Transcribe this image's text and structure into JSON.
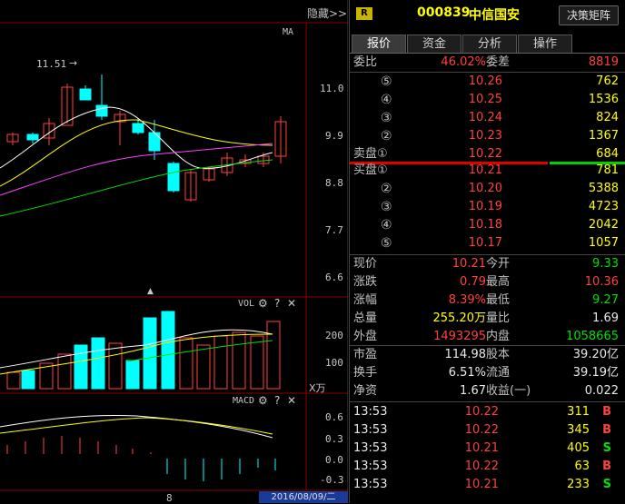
{
  "left": {
    "hide_label": "隐藏>>",
    "ma_label": "MA",
    "high_marker": "11.51",
    "price_ticks": [
      "11.0",
      "9.9",
      "8.8",
      "7.7",
      "6.6"
    ],
    "vol_label": "VOL",
    "vol_ticks": [
      "200",
      "100"
    ],
    "vol_unit": "X万",
    "macd_label": "MACD",
    "macd_ticks": [
      "0.6",
      "0.3",
      "0.0",
      "-0.3"
    ],
    "bottom_mark": "8",
    "date_label": "2016/08/09/二"
  },
  "header": {
    "badge": "R",
    "code": "000839",
    "name": "中信国安",
    "decision_button": "决策矩阵"
  },
  "tabs": [
    "报价",
    "资金",
    "分析",
    "操作"
  ],
  "weibi": {
    "label1": "委比",
    "value1": "46.02%",
    "label2": "委差",
    "value2": "8819"
  },
  "asks": [
    {
      "level": "⑤",
      "price": "10.26",
      "vol": "762"
    },
    {
      "level": "④",
      "price": "10.25",
      "vol": "1536"
    },
    {
      "level": "③",
      "price": "10.24",
      "vol": "824"
    },
    {
      "level": "②",
      "price": "10.23",
      "vol": "1367"
    },
    {
      "level": "卖盘①",
      "price": "10.22",
      "vol": "684"
    }
  ],
  "bids": [
    {
      "level": "买盘①",
      "price": "10.21",
      "vol": "781"
    },
    {
      "level": "②",
      "price": "10.20",
      "vol": "5388"
    },
    {
      "level": "③",
      "price": "10.19",
      "vol": "4723"
    },
    {
      "level": "④",
      "price": "10.18",
      "vol": "2042"
    },
    {
      "level": "⑤",
      "price": "10.17",
      "vol": "1057"
    }
  ],
  "stats": [
    {
      "l1": "现价",
      "v1": "10.21",
      "c1": "red",
      "l2": "今开",
      "v2": "9.33",
      "c2": "green"
    },
    {
      "l1": "涨跌",
      "v1": "0.79",
      "c1": "red",
      "l2": "最高",
      "v2": "10.36",
      "c2": "red"
    },
    {
      "l1": "涨幅",
      "v1": "8.39%",
      "c1": "red",
      "l2": "最低",
      "v2": "9.27",
      "c2": "green"
    },
    {
      "l1": "总量",
      "v1": "255.20万",
      "c1": "yellow",
      "l2": "量比",
      "v2": "1.69",
      "c2": "white"
    },
    {
      "l1": "外盘",
      "v1": "1493295",
      "c1": "red",
      "l2": "内盘",
      "v2": "1058665",
      "c2": "green"
    }
  ],
  "fundamentals": [
    {
      "l1": "市盈",
      "v1": "114.98",
      "l2": "股本",
      "v2": "39.20亿"
    },
    {
      "l1": "换手",
      "v1": "6.51%",
      "l2": "流通",
      "v2": "39.19亿"
    },
    {
      "l1": "净资",
      "v1": "1.67",
      "l2": "收益(一)",
      "v2": "0.022"
    }
  ],
  "ticks": [
    {
      "time": "13:53",
      "price": "10.22",
      "vol": "311",
      "side": "B"
    },
    {
      "time": "13:53",
      "price": "10.22",
      "vol": "345",
      "side": "B"
    },
    {
      "time": "13:53",
      "price": "10.21",
      "vol": "405",
      "side": "S"
    },
    {
      "time": "13:53",
      "price": "10.22",
      "vol": "63",
      "side": "B"
    },
    {
      "time": "13:53",
      "price": "10.21",
      "vol": "233",
      "side": "S"
    }
  ],
  "colors": {
    "up": "#ff4040",
    "down": "#00ffff",
    "ma5": "#ffffff",
    "ma10": "#ffff00",
    "ma20": "#ff40ff",
    "ma60": "#00e000"
  }
}
